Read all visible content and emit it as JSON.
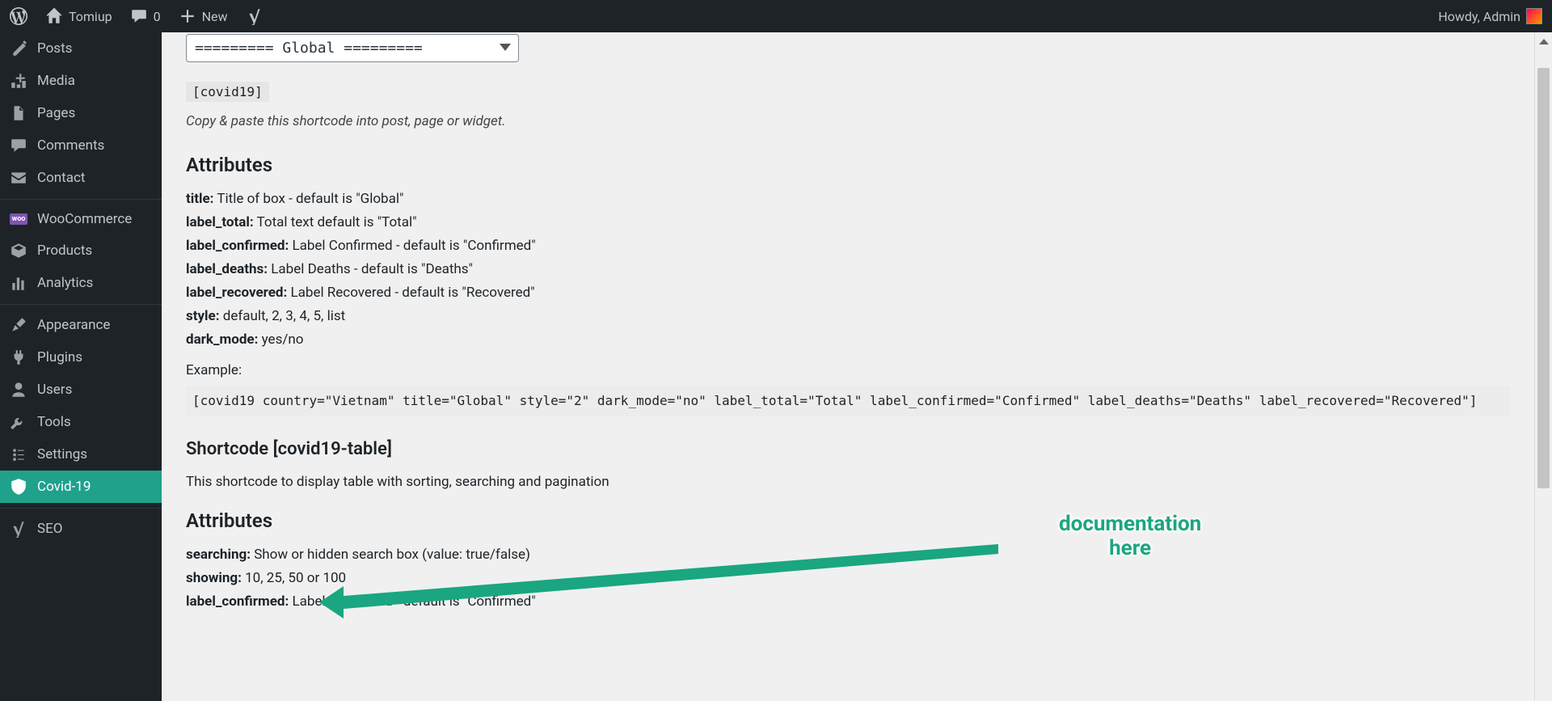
{
  "adminbar": {
    "site_name": "Tomiup",
    "comments_count": "0",
    "new_label": "New",
    "howdy": "Howdy, Admin"
  },
  "sidebar": {
    "items": [
      {
        "id": "posts",
        "label": "Posts"
      },
      {
        "id": "media",
        "label": "Media"
      },
      {
        "id": "pages",
        "label": "Pages"
      },
      {
        "id": "comments",
        "label": "Comments"
      },
      {
        "id": "contact",
        "label": "Contact"
      },
      {
        "id": "woocommerce",
        "label": "WooCommerce"
      },
      {
        "id": "products",
        "label": "Products"
      },
      {
        "id": "analytics",
        "label": "Analytics"
      },
      {
        "id": "appearance",
        "label": "Appearance"
      },
      {
        "id": "plugins",
        "label": "Plugins"
      },
      {
        "id": "users",
        "label": "Users"
      },
      {
        "id": "tools",
        "label": "Tools"
      },
      {
        "id": "settings",
        "label": "Settings"
      },
      {
        "id": "covid19",
        "label": "Covid-19"
      },
      {
        "id": "seo",
        "label": "SEO"
      }
    ]
  },
  "content": {
    "select_value": "========= Global =========",
    "shortcode_1": "[covid19]",
    "hint": "Copy & paste this shortcode into post, page or widget.",
    "heading_attributes": "Attributes",
    "attrs1": [
      {
        "name": "title:",
        "desc": " Title of box - default is \"Global\""
      },
      {
        "name": "label_total:",
        "desc": " Total text default is \"Total\""
      },
      {
        "name": "label_confirmed:",
        "desc": " Label Confirmed - default is \"Confirmed\""
      },
      {
        "name": "label_deaths:",
        "desc": " Label Deaths - default is \"Deaths\""
      },
      {
        "name": "label_recovered:",
        "desc": " Label Recovered - default is \"Recovered\""
      },
      {
        "name": "style:",
        "desc": " default, 2, 3, 4, 5, list"
      },
      {
        "name": "dark_mode:",
        "desc": " yes/no"
      }
    ],
    "example_label": "Example:",
    "example_code": "[covid19 country=\"Vietnam\" title=\"Global\" style=\"2\" dark_mode=\"no\" label_total=\"Total\" label_confirmed=\"Confirmed\" label_deaths=\"Deaths\" label_recovered=\"Recovered\"]",
    "heading_shortcode2": "Shortcode [covid19-table]",
    "shortcode2_desc": "This shortcode to display table with sorting, searching and pagination",
    "attrs2": [
      {
        "name": "searching:",
        "desc": " Show or hidden search box (value: true/false)"
      },
      {
        "name": "showing:",
        "desc": " 10, 25, 50 or 100"
      },
      {
        "name": "label_confirmed:",
        "desc": " Label Confirmed - default is \"Confirmed\""
      }
    ]
  },
  "annotation": {
    "line1": "documentation",
    "line2": "here"
  }
}
